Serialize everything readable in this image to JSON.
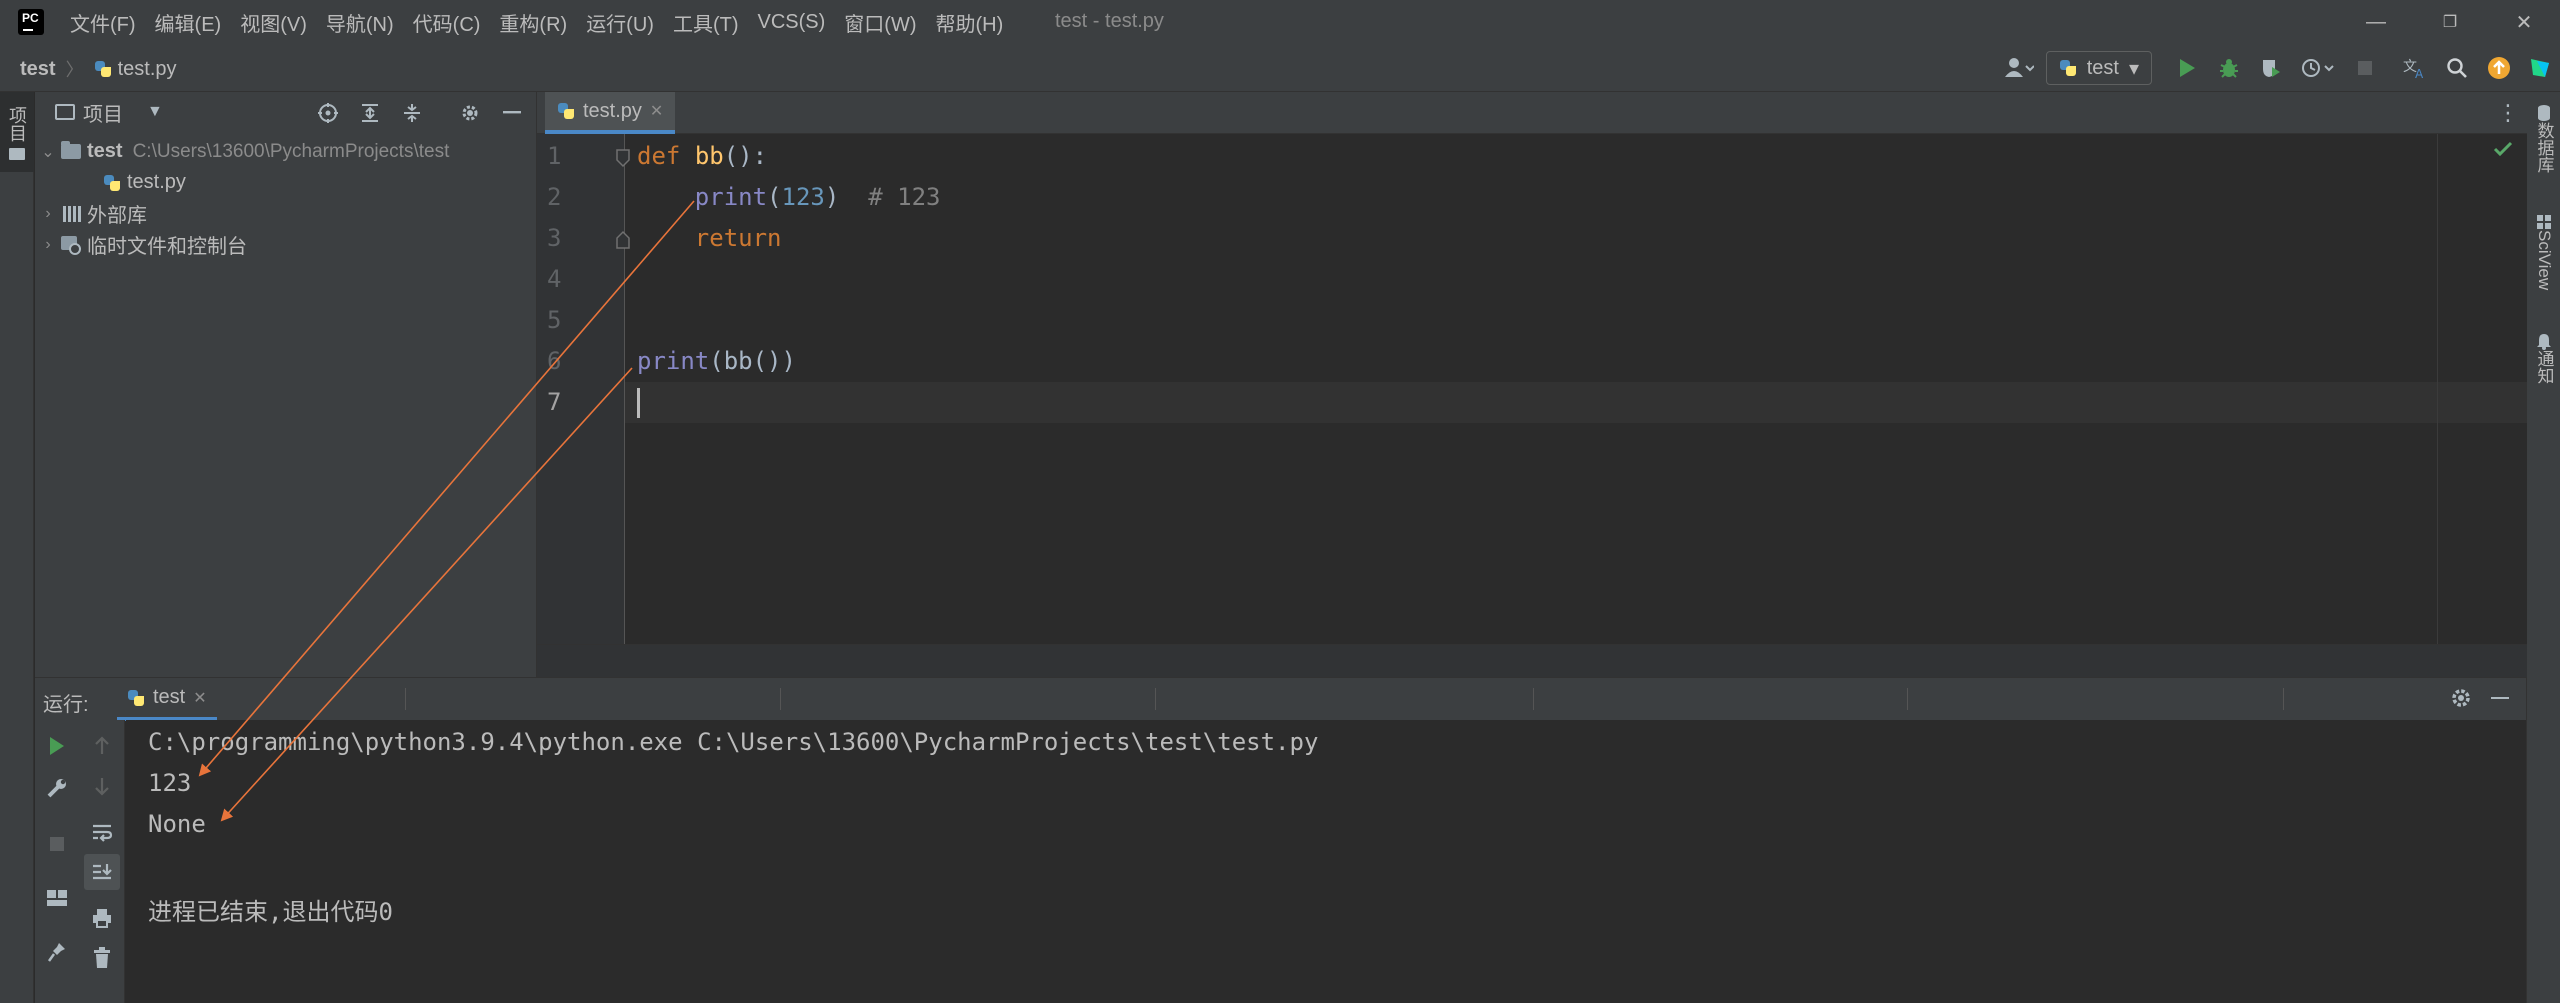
{
  "titlebar": {
    "menu": [
      "文件(F)",
      "编辑(E)",
      "视图(V)",
      "导航(N)",
      "代码(C)",
      "重构(R)",
      "运行(U)",
      "工具(T)",
      "VCS(S)",
      "窗口(W)",
      "帮助(H)"
    ],
    "window_title": "test - test.py",
    "minimize": "—",
    "restore": "❐",
    "close": "✕"
  },
  "navbar": {
    "project": "test",
    "separator": "〉",
    "file": "test.py"
  },
  "toolbar": {
    "run_config": "test",
    "dropdown": "▾"
  },
  "left_stripe": {
    "project_tab": "项目"
  },
  "right_stripe": {
    "database": "数据库",
    "sciview": "SciView",
    "notifications": "通知"
  },
  "project_panel": {
    "title": "项目",
    "tree": {
      "root_name": "test",
      "root_path": "C:\\Users\\13600\\PycharmProjects\\test",
      "file": "test.py",
      "external_libs": "外部库",
      "scratches": "临时文件和控制台"
    }
  },
  "editor": {
    "tab_label": "test.py",
    "tab_close": "✕",
    "line_numbers": [
      "1",
      "2",
      "3",
      "4",
      "5",
      "6",
      "7"
    ],
    "code": {
      "l1_kw": "def",
      "l1_fn": "bb",
      "l1_rest": "():",
      "l2_bi": "print",
      "l2_open": "(",
      "l2_num": "123",
      "l2_close": ")  ",
      "l2_comment": "# 123",
      "l3_kw": "return",
      "l6_bi": "print",
      "l6_rest": "(bb())"
    }
  },
  "run_panel": {
    "label": "运行:",
    "tab": "test",
    "tab_close": "✕",
    "output": [
      "C:\\programming\\python3.9.4\\python.exe C:\\Users\\13600\\PycharmProjects\\test\\test.py",
      "123",
      "None",
      "",
      "进程已结束,退出代码0"
    ]
  },
  "colors": {
    "accent_tab": "#4a88c7",
    "annotation_arrow": "#e8743b",
    "run_green": "#499c54",
    "check_green": "#59a869"
  }
}
